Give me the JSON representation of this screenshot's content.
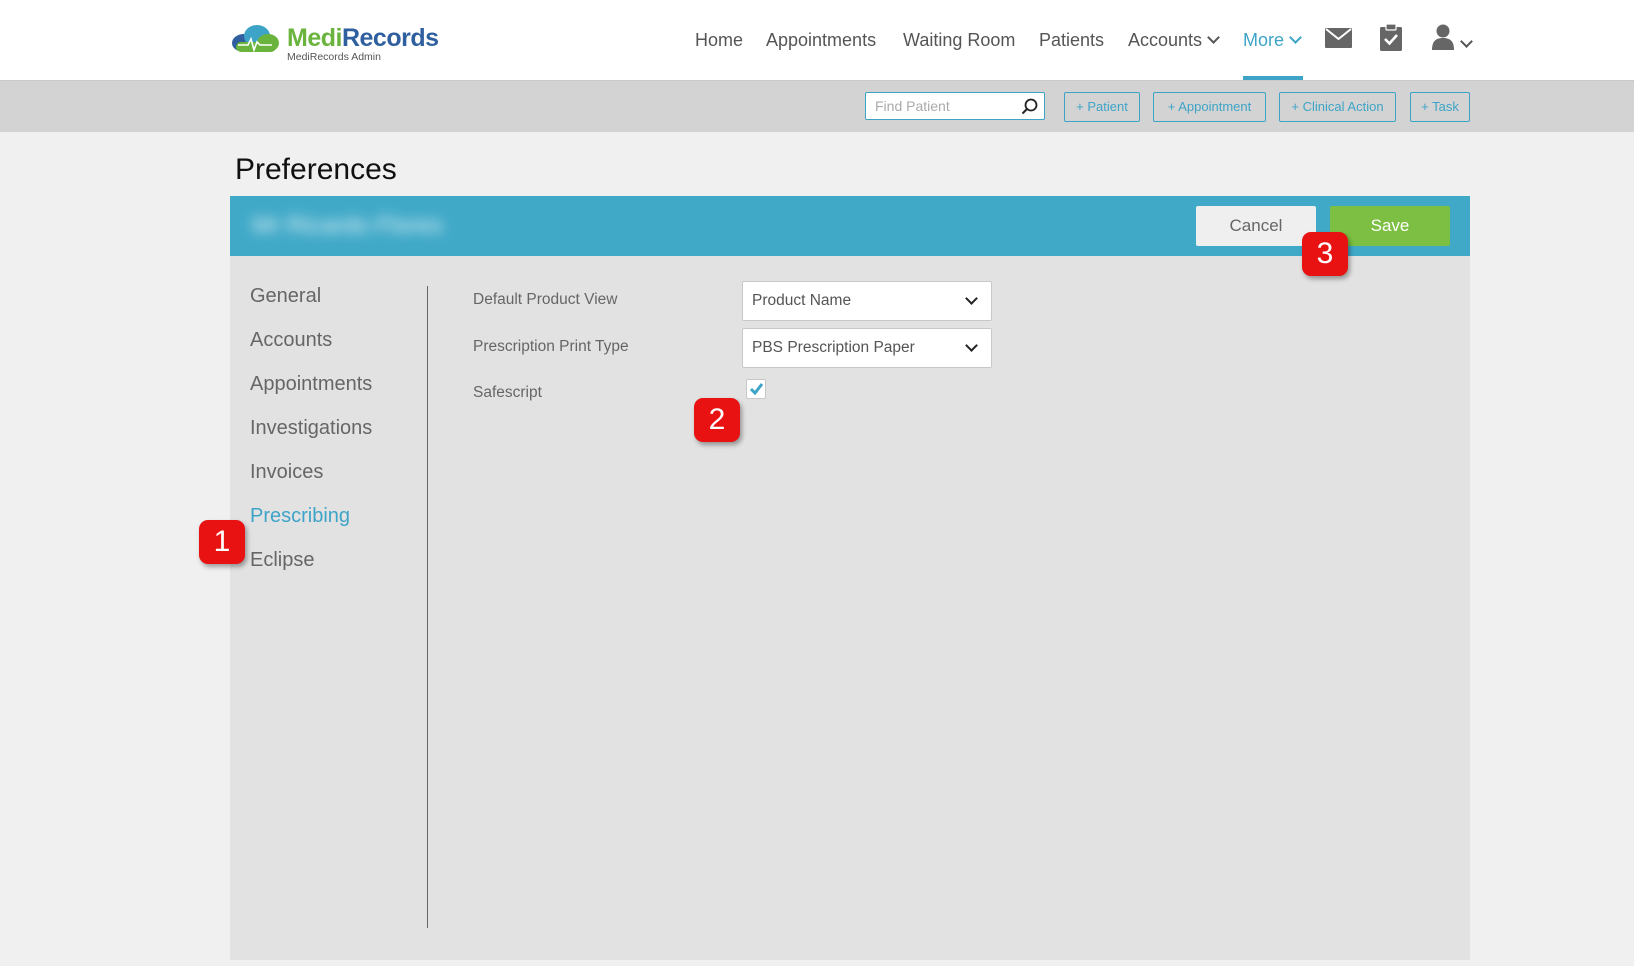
{
  "brand": {
    "name_part1": "Medi",
    "name_part2": "Records",
    "subtitle": "MediRecords Admin",
    "green": "#6ab33d",
    "blue": "#2f5f9e"
  },
  "nav": {
    "items": [
      {
        "label": "Home"
      },
      {
        "label": "Appointments"
      },
      {
        "label": "Waiting Room"
      },
      {
        "label": "Patients"
      },
      {
        "label": "Accounts",
        "has_dropdown": true
      },
      {
        "label": "More",
        "has_dropdown": true,
        "active": true
      }
    ],
    "icons": [
      "mail-icon",
      "clipboard-check-icon",
      "user-icon"
    ],
    "accent": "#3ea4c7"
  },
  "actionbar": {
    "search_placeholder": "Find Patient",
    "buttons": [
      {
        "label": "+ Patient"
      },
      {
        "label": "+ Appointment"
      },
      {
        "label": "+ Clinical Action"
      },
      {
        "label": "+ Task"
      }
    ]
  },
  "page": {
    "title": "Preferences",
    "patient_name": "Mr Ricardo Flores",
    "cancel_label": "Cancel",
    "save_label": "Save"
  },
  "sidebar": {
    "items": [
      {
        "label": "General"
      },
      {
        "label": "Accounts"
      },
      {
        "label": "Appointments"
      },
      {
        "label": "Investigations"
      },
      {
        "label": "Invoices"
      },
      {
        "label": "Prescribing",
        "active": true
      },
      {
        "label": "Eclipse"
      }
    ]
  },
  "form": {
    "default_product_view": {
      "label": "Default Product View",
      "value": "Product Name"
    },
    "prescription_print_type": {
      "label": "Prescription Print Type",
      "value": "PBS Prescription Paper"
    },
    "safescript": {
      "label": "Safescript",
      "checked": true
    }
  },
  "badges": [
    "1",
    "2",
    "3"
  ]
}
